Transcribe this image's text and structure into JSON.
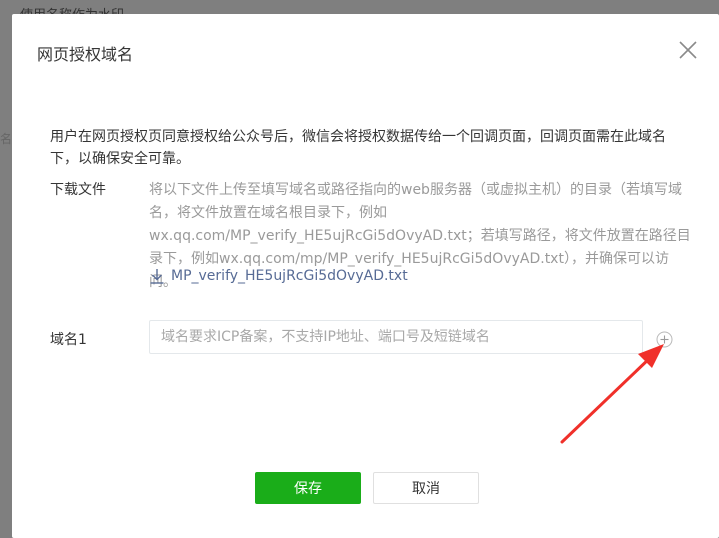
{
  "background": {
    "text": "使用名称作为水印"
  },
  "dialog": {
    "title": "网页授权域名",
    "description": "用户在网页授权页同意授权给公众号后，微信会将授权数据传给一个回调页面，回调页面需在此域名下，以确保安全可靠。",
    "download": {
      "label": "下载文件",
      "help": "将以下文件上传至填写域名或路径指向的web服务器（或虚拟主机）的目录（若填写域名，将文件放置在域名根目录下，例如wx.qq.com/MP_verify_HE5ujRcGi5dOvyAD.txt；若填写路径，将文件放置在路径目录下，例如wx.qq.com/mp/MP_verify_HE5ujRcGi5dOvyAD.txt），并确保可以访问。",
      "file_name": "MP_verify_HE5ujRcGi5dOvyAD.txt"
    },
    "domain": {
      "label": "域名1",
      "value": "",
      "placeholder": "域名要求ICP备案，不支持IP地址、端口号及短链域名"
    },
    "buttons": {
      "save": "保存",
      "cancel": "取消"
    }
  },
  "colors": {
    "primary": "#1aad19",
    "link": "#576b95",
    "annotation_arrow": "#f0302a",
    "overlay": "#7f7f7f"
  },
  "icons": [
    "close-icon",
    "download-icon",
    "plus-circle-icon"
  ]
}
